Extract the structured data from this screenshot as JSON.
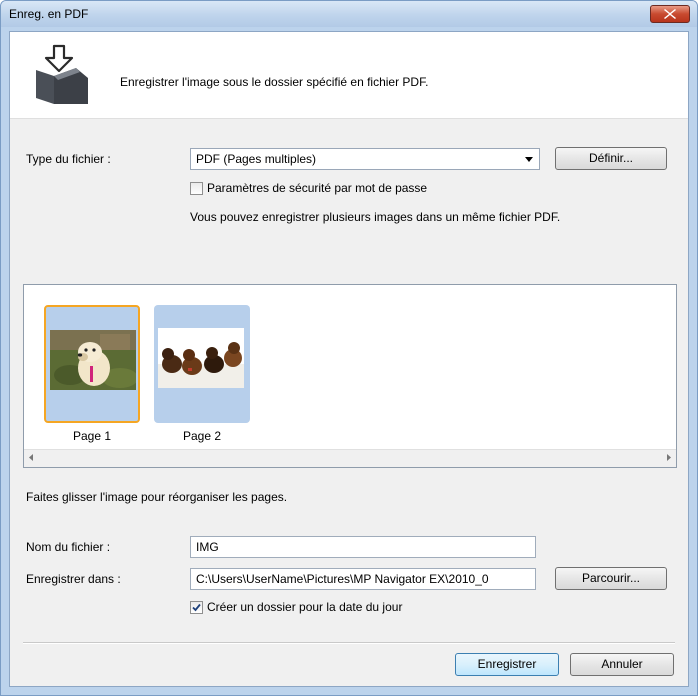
{
  "window": {
    "title": "Enreg. en PDF"
  },
  "header": {
    "icon": "save-to-folder-icon",
    "description": "Enregistrer l'image sous le dossier spécifié en fichier PDF."
  },
  "file_type": {
    "label": "Type du fichier :",
    "selected": "PDF (Pages multiples)",
    "define_button": "Définir..."
  },
  "security": {
    "label": "Paramètres de sécurité par mot de passe",
    "checked": false
  },
  "info_text": "Vous pouvez enregistrer plusieurs images dans un même fichier PDF.",
  "pages": [
    {
      "label": "Page 1",
      "selected": true,
      "image": "dog-photo"
    },
    {
      "label": "Page 2",
      "selected": false,
      "image": "dogs-group-photo"
    }
  ],
  "reorder_hint": "Faites glisser l'image pour réorganiser les pages.",
  "file_name": {
    "label": "Nom du fichier :",
    "value": "IMG"
  },
  "save_in": {
    "label": "Enregistrer dans :",
    "value": "C:\\Users\\UserName\\Pictures\\MP Navigator EX\\2010_0",
    "browse_button": "Parcourir..."
  },
  "date_folder": {
    "label": "Créer un dossier pour la date du jour",
    "checked": true
  },
  "buttons": {
    "save": "Enregistrer",
    "cancel": "Annuler"
  },
  "colors": {
    "selection_border": "#f5a623",
    "thumb_background": "#b7cfeb",
    "close_button": "#c84a2f"
  }
}
